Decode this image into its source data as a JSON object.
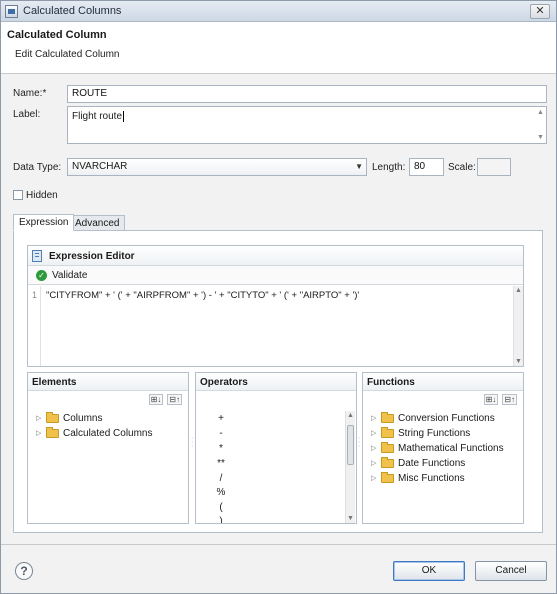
{
  "window": {
    "title": "Calculated Columns",
    "close_glyph": "✕"
  },
  "header": {
    "title": "Calculated Column",
    "subtitle": "Edit Calculated Column"
  },
  "form": {
    "name_label": "Name:*",
    "name_value": "ROUTE",
    "label_label": "Label:",
    "label_value": "Flight route",
    "datatype_label": "Data Type:",
    "datatype_value": "NVARCHAR",
    "length_label": "Length:",
    "length_value": "80",
    "scale_label": "Scale:",
    "scale_value": "",
    "hidden_label": "Hidden",
    "hidden_checked": false
  },
  "tabs": [
    {
      "label": "Expression",
      "active": true
    },
    {
      "label": "Advanced",
      "active": false
    }
  ],
  "editor": {
    "title": "Expression Editor",
    "validate_label": "Validate",
    "line_number": "1",
    "expression": "\"CITYFROM\" + ' (' + \"AIRPFROM\" + ') - ' + \"CITYTO\" + ' (' + \"AIRPTO\" + ')'"
  },
  "elements_pane": {
    "title": "Elements",
    "tools": [
      "⊞↓",
      "⊟↑"
    ],
    "items": [
      {
        "label": "Columns",
        "icon": "folder-icon"
      },
      {
        "label": "Calculated Columns",
        "icon": "folder-icon"
      }
    ]
  },
  "operators_pane": {
    "title": "Operators",
    "items": [
      "+",
      "-",
      "*",
      "**",
      "/",
      "%",
      "(",
      ")"
    ]
  },
  "functions_pane": {
    "title": "Functions",
    "tools": [
      "⊞↓",
      "⊟↑"
    ],
    "items": [
      {
        "label": "Conversion Functions",
        "icon": "folder-icon"
      },
      {
        "label": "String Functions",
        "icon": "folder-icon"
      },
      {
        "label": "Mathematical Functions",
        "icon": "folder-icon"
      },
      {
        "label": "Date Functions",
        "icon": "folder-icon"
      },
      {
        "label": "Misc Functions",
        "icon": "folder-icon"
      }
    ]
  },
  "footer": {
    "help_glyph": "?",
    "ok_label": "OK",
    "cancel_label": "Cancel"
  },
  "colors": {
    "accent": "#3f79c0",
    "validate_green": "#2e9a3b",
    "folder": "#f1c24b"
  }
}
